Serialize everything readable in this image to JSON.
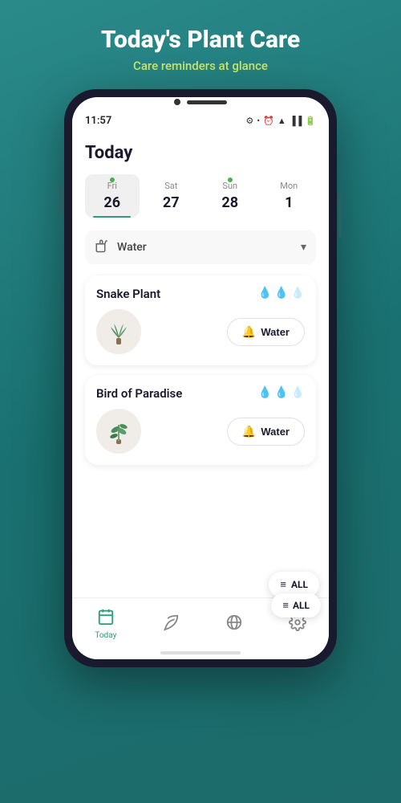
{
  "header": {
    "title": "Today's Plant Care",
    "subtitle": "Care reminders at glance"
  },
  "status_bar": {
    "time": "11:57",
    "settings_label": "⚙",
    "dot_label": "•"
  },
  "section": {
    "title": "Today"
  },
  "calendar": {
    "days": [
      {
        "name": "Fri",
        "num": "26",
        "active": true,
        "dot": true,
        "dot_color": "#4caf50"
      },
      {
        "name": "Sat",
        "num": "27",
        "active": false,
        "dot": false,
        "dot_color": ""
      },
      {
        "name": "Sun",
        "num": "28",
        "active": false,
        "dot": true,
        "dot_color": "#4caf50"
      },
      {
        "name": "Mon",
        "num": "1",
        "active": false,
        "dot": false,
        "dot_color": ""
      }
    ]
  },
  "filter": {
    "icon": "△○",
    "label": "Water",
    "chevron": "▾"
  },
  "plants": [
    {
      "name": "Snake Plant",
      "drops_filled": 2,
      "drops_total": 3,
      "emoji": "🪴",
      "water_label": "Water",
      "bell_color": "orange"
    },
    {
      "name": "Bird of Paradise",
      "drops_filled": 2,
      "drops_total": 3,
      "emoji": "🌿",
      "water_label": "Water",
      "bell_color": "green"
    }
  ],
  "fab": {
    "icon": "≡",
    "label": "ALL"
  },
  "bottom_nav": [
    {
      "icon": "📅",
      "label": "Today",
      "active": true
    },
    {
      "icon": "🌿",
      "label": "",
      "active": false
    },
    {
      "icon": "🌐",
      "label": "",
      "active": false
    },
    {
      "icon": "⚙",
      "label": "",
      "active": false
    }
  ]
}
